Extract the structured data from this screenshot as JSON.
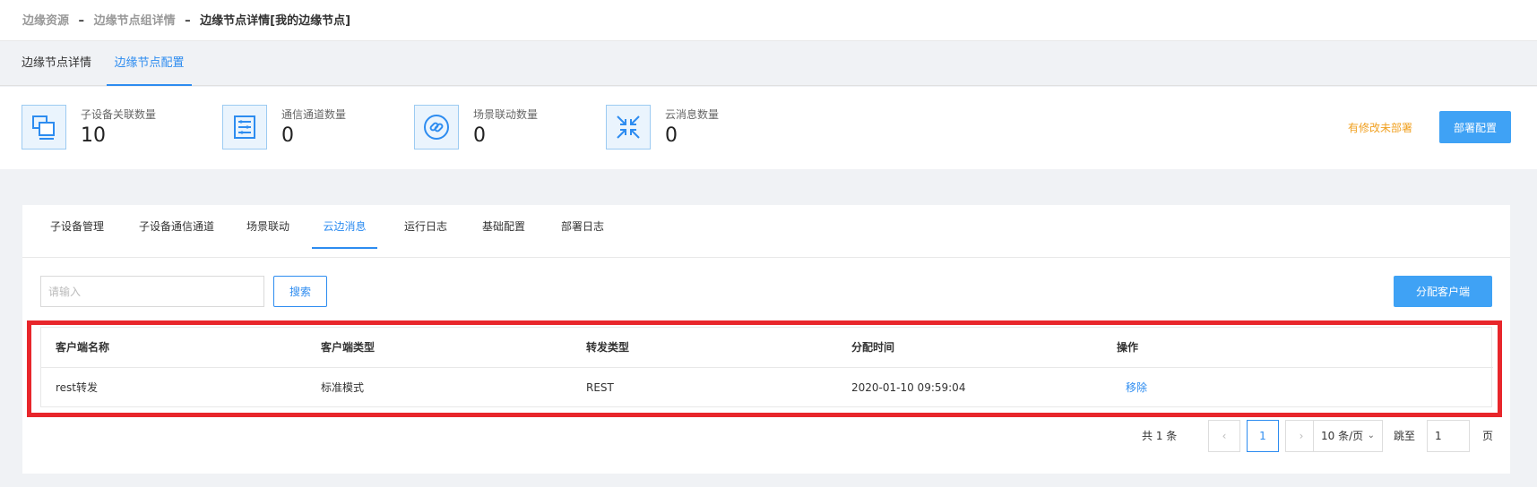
{
  "breadcrumb": {
    "items": [
      "边缘资源",
      "边缘节点组详情"
    ],
    "separator": "–",
    "current": "边缘节点详情[我的边缘节点]"
  },
  "top_tabs": [
    {
      "label": "边缘节点详情",
      "active": false
    },
    {
      "label": "边缘节点配置",
      "active": true
    }
  ],
  "stats": [
    {
      "label": "子设备关联数量",
      "value": "10",
      "icon": "device-link-icon"
    },
    {
      "label": "通信通道数量",
      "value": "0",
      "icon": "channel-list-icon"
    },
    {
      "label": "场景联动数量",
      "value": "0",
      "icon": "link-icon"
    },
    {
      "label": "云消息数量",
      "value": "0",
      "icon": "arrows-converge-icon"
    }
  ],
  "status": {
    "unsaved_text": "有修改未部署"
  },
  "actions": {
    "deploy_label": "部署配置"
  },
  "sub_tabs": [
    {
      "label": "子设备管理",
      "active": false
    },
    {
      "label": "子设备通信通道",
      "active": false
    },
    {
      "label": "场景联动",
      "active": false
    },
    {
      "label": "云边消息",
      "active": true
    },
    {
      "label": "运行日志",
      "active": false
    },
    {
      "label": "基础配置",
      "active": false
    },
    {
      "label": "部署日志",
      "active": false
    }
  ],
  "search": {
    "placeholder": "请输入",
    "value": "",
    "button_label": "搜索"
  },
  "assign_button_label": "分配客户端",
  "table": {
    "columns": [
      "客户端名称",
      "客户端类型",
      "转发类型",
      "分配时间",
      "操作"
    ],
    "rows": [
      {
        "name": "rest转发",
        "client_type": "标准模式",
        "forward_type": "REST",
        "assigned_at": "2020-01-10 09:59:04",
        "action": "移除"
      }
    ]
  },
  "pagination": {
    "total_text": "共 1 条",
    "prev_symbol": "‹",
    "next_symbol": "›",
    "current_page": "1",
    "page_size": "10 条/页",
    "page_size_caret": "⌄",
    "jump_label": "跳至",
    "jump_value": "1",
    "page_unit": "页"
  },
  "colors": {
    "accent": "#2d8cf0",
    "button": "#3fa2f5",
    "warning": "#f0a020",
    "highlight": "#e8262b"
  }
}
